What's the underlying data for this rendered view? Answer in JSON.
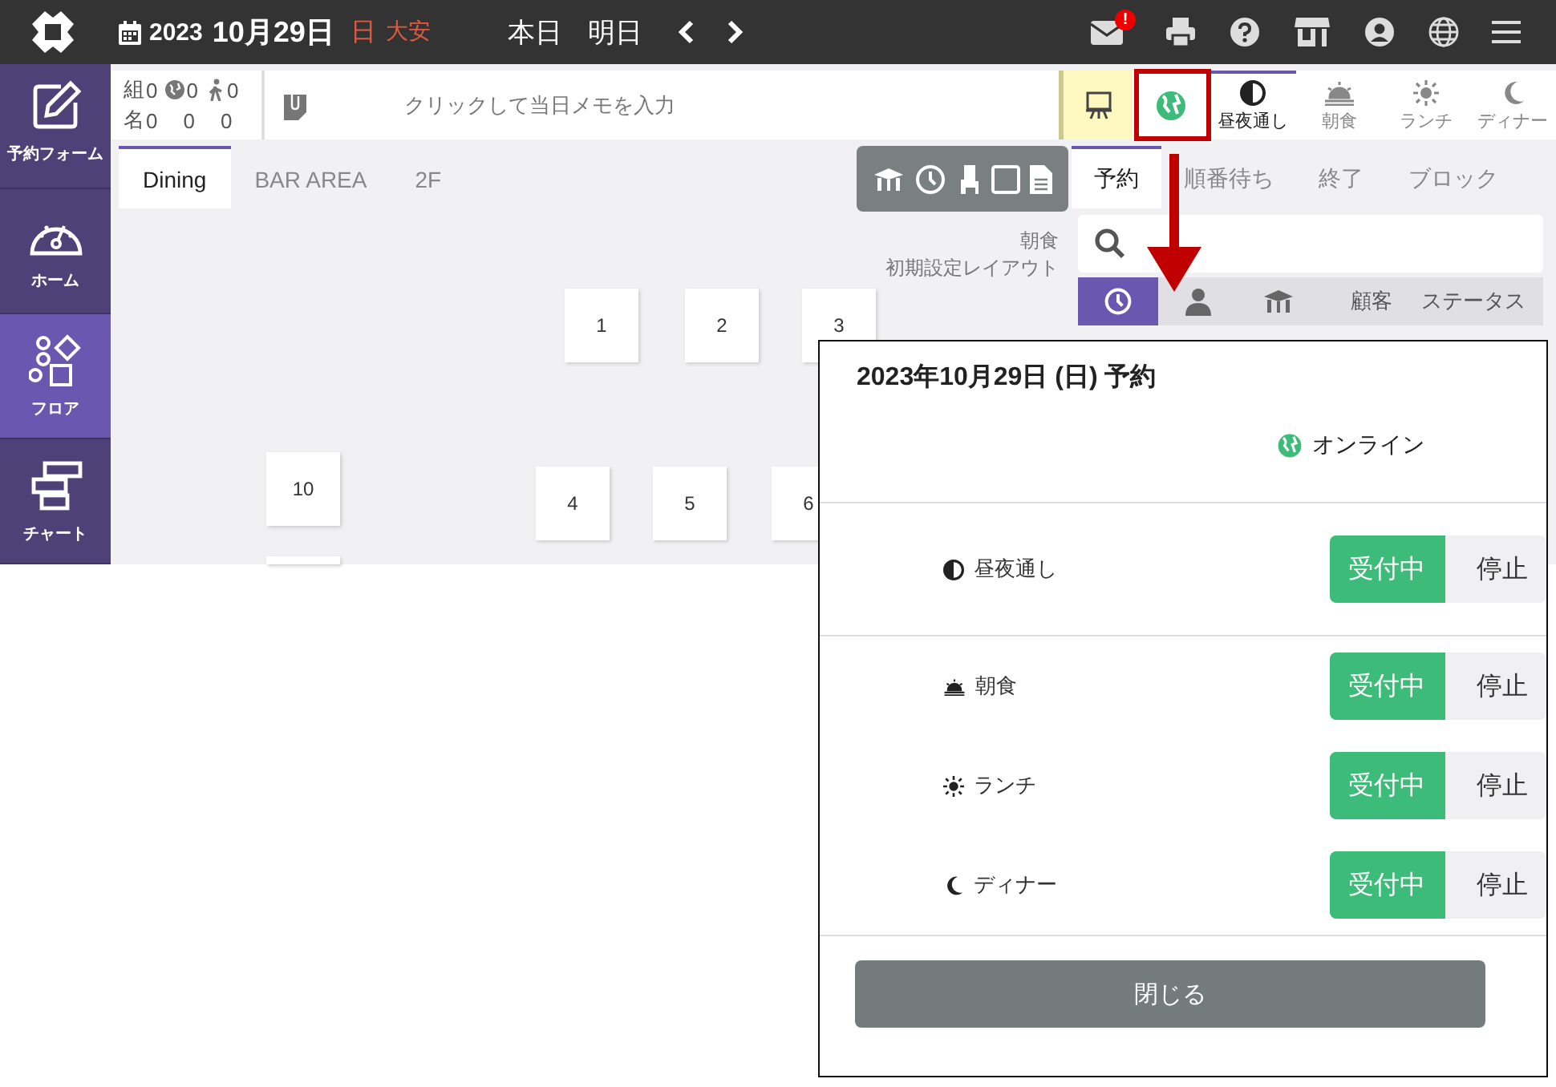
{
  "topbar": {
    "year": "2023",
    "date": "10月29日",
    "weekday": "日",
    "rokuyo": "大安",
    "nav": [
      "本日",
      "明日"
    ],
    "mail_badge": "!"
  },
  "sidebar": {
    "items": [
      {
        "label": "予約フォーム",
        "kind": "edit",
        "selected": false
      },
      {
        "label": "ホーム",
        "kind": "gauge",
        "selected": false
      },
      {
        "label": "フロア",
        "kind": "shapes",
        "selected": true
      },
      {
        "label": "チャート",
        "kind": "chart",
        "selected": false
      }
    ]
  },
  "stats": {
    "rows": [
      {
        "label": "組",
        "values": [
          "0",
          "0",
          "0"
        ]
      },
      {
        "label": "名",
        "values": [
          "0",
          "0",
          "0"
        ]
      }
    ]
  },
  "memo": {
    "placeholder": "クリックして当日メモを入力"
  },
  "meal_tabs": [
    {
      "label": "昼夜通し",
      "kind": "half",
      "selected": true
    },
    {
      "label": "朝食",
      "kind": "sunrise",
      "selected": false
    },
    {
      "label": "ランチ",
      "kind": "sun",
      "selected": false
    },
    {
      "label": "ディナー",
      "kind": "moon",
      "selected": false
    }
  ],
  "floor": {
    "tabs": [
      {
        "label": "Dining",
        "selected": true
      },
      {
        "label": "BAR AREA",
        "selected": false
      },
      {
        "label": "2F",
        "selected": false
      }
    ],
    "layout_meal": "朝食",
    "layout_name": "初期設定レイアウト",
    "tables": [
      {
        "label": "1"
      },
      {
        "label": "2"
      },
      {
        "label": "3"
      },
      {
        "label": "10"
      },
      {
        "label": "4"
      },
      {
        "label": "5"
      },
      {
        "label": "6"
      }
    ]
  },
  "panel": {
    "tabs": [
      {
        "label": "予約",
        "selected": true
      },
      {
        "label": "順番待ち",
        "selected": false
      },
      {
        "label": "終了",
        "selected": false
      },
      {
        "label": "ブロック",
        "selected": false
      }
    ],
    "columns": [
      {
        "kind": "clock",
        "selected": true
      },
      {
        "kind": "person",
        "selected": false
      },
      {
        "kind": "table",
        "selected": false
      },
      {
        "kind": "text",
        "label": "顧客",
        "selected": false
      },
      {
        "kind": "text",
        "label": "ステータス",
        "selected": false
      }
    ]
  },
  "modal": {
    "title": "2023年10月29日 (日) 予約",
    "channel": "オンライン",
    "rows": [
      {
        "label": "昼夜通し",
        "kind": "half",
        "options": [
          {
            "label": "受付中",
            "selected": true
          },
          {
            "label": "停止",
            "selected": false
          }
        ]
      },
      {
        "label": "朝食",
        "kind": "sunrise",
        "options": [
          {
            "label": "受付中",
            "selected": true
          },
          {
            "label": "停止",
            "selected": false
          }
        ]
      },
      {
        "label": "ランチ",
        "kind": "sun",
        "options": [
          {
            "label": "受付中",
            "selected": true
          },
          {
            "label": "停止",
            "selected": false
          }
        ]
      },
      {
        "label": "ディナー",
        "kind": "moon",
        "options": [
          {
            "label": "受付中",
            "selected": true
          },
          {
            "label": "停止",
            "selected": false
          }
        ]
      }
    ],
    "close": "閉じる"
  },
  "callout": {
    "color": "#c00000"
  }
}
